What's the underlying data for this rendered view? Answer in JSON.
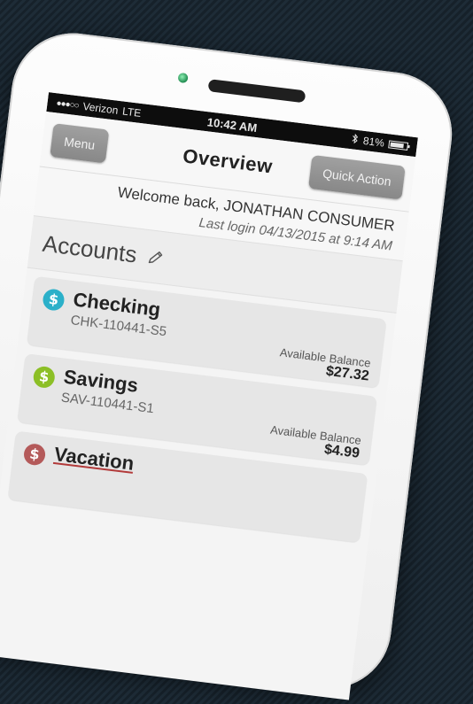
{
  "status_bar": {
    "signal": "●●●○○",
    "carrier": "Verizon",
    "network": "LTE",
    "time": "10:42 AM",
    "battery": "81%"
  },
  "nav": {
    "menu_label": "Menu",
    "title": "Overview",
    "quick_action_label": "Quick Action"
  },
  "welcome": {
    "greeting": "Welcome back, JONATHAN CONSUMER",
    "last_login": "Last login 04/13/2015 at 9:14 AM"
  },
  "accounts": {
    "title": "Accounts",
    "items": [
      {
        "name": "Checking",
        "number": "CHK-110441-S5",
        "balance_label": "Available Balance",
        "balance": "$27.32",
        "icon_color": "#2bb0c9"
      },
      {
        "name": "Savings",
        "number": "SAV-110441-S1",
        "balance_label": "Available Balance",
        "balance": "$4.99",
        "icon_color": "#8cbf26"
      },
      {
        "name": "Vacation",
        "icon_color": "#b45a5a"
      }
    ]
  },
  "icon_symbol": "$"
}
